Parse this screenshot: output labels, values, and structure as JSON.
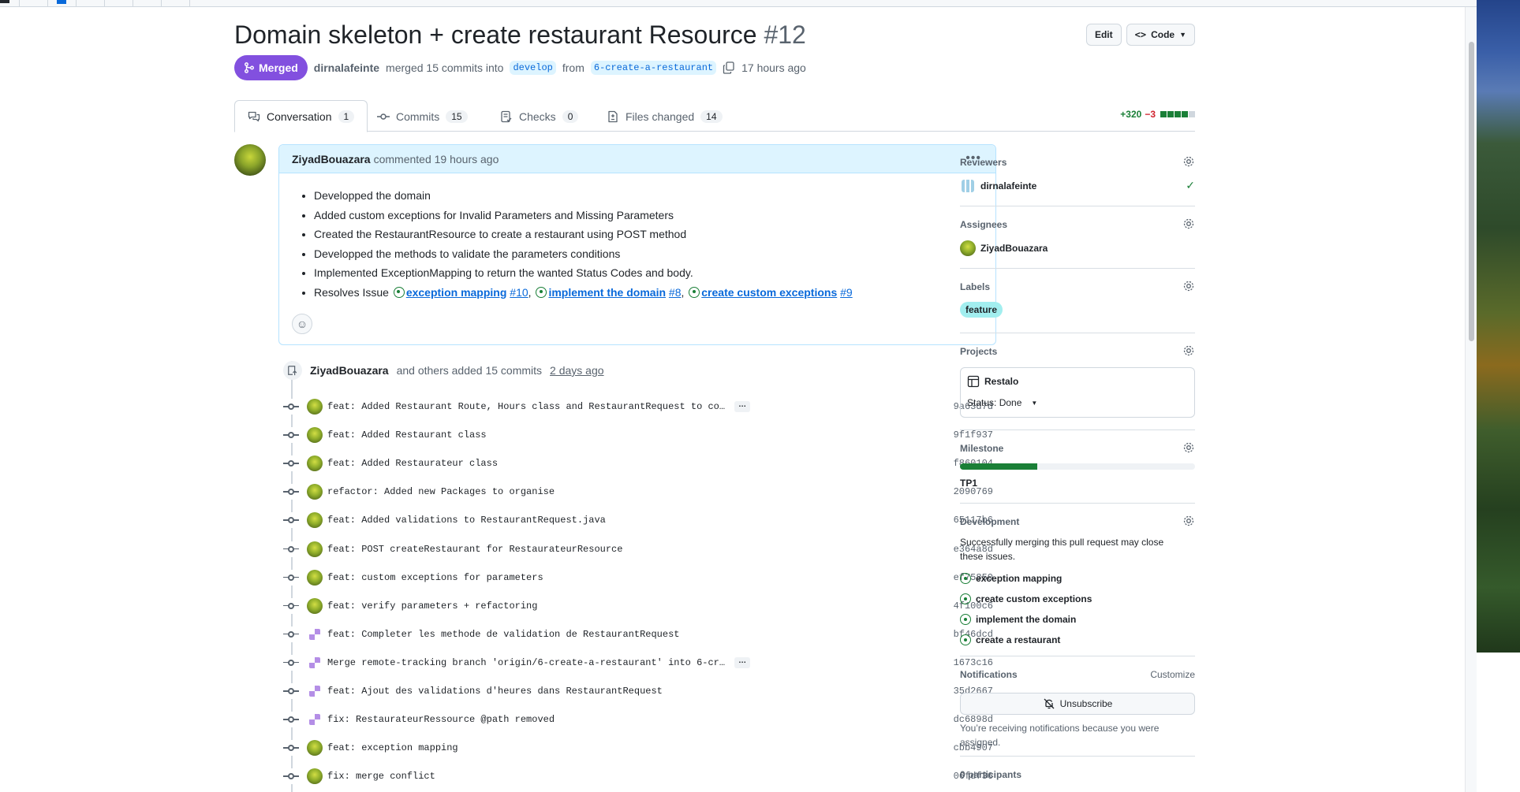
{
  "pr": {
    "title": "Domain skeleton + create restaurant Resource",
    "number": "#12",
    "edit_label": "Edit",
    "code_label": "Code",
    "status": "Merged",
    "merger": "dirnalafeinte",
    "merge_text": "merged 15 commits into",
    "base_branch": "develop",
    "from_text": "from",
    "head_branch": "6-create-a-restaurant",
    "time": "17 hours ago"
  },
  "tabs": [
    {
      "label": "Conversation",
      "count": "1"
    },
    {
      "label": "Commits",
      "count": "15"
    },
    {
      "label": "Checks",
      "count": "0"
    },
    {
      "label": "Files changed",
      "count": "14"
    }
  ],
  "diffstat": {
    "additions": "+320",
    "deletions": "−3"
  },
  "comment": {
    "author": "ZiyadBouazara",
    "meta": "commented 19 hours ago",
    "items": [
      "Developped the domain",
      "Added custom exceptions for Invalid Parameters and Missing Parameters",
      "Created the RestaurantResource to create a restaurant using POST method",
      "Developped the methods to validate the parameters conditions",
      "Implemented ExceptionMapping to return the wanted Status Codes and body."
    ],
    "resolves_prefix": "Resolves Issue",
    "issues": [
      {
        "title": "exception mapping",
        "num": "#10"
      },
      {
        "title": "implement the domain",
        "num": "#8"
      },
      {
        "title": "create custom exceptions",
        "num": "#9"
      }
    ],
    "separator": ","
  },
  "commits_header": {
    "author": "ZiyadBouazara",
    "text": "and others added 15 commits",
    "time": "2 days ago"
  },
  "commits": [
    {
      "msg": "feat: Added Restaurant Route, Hours class and RestaurantRequest to co…",
      "sha": "9a63d7d",
      "avatar": "green",
      "more": "…"
    },
    {
      "msg": "feat: Added Restaurant class",
      "sha": "9f1f937",
      "avatar": "green"
    },
    {
      "msg": "feat: Added Restaurateur class",
      "sha": "f860104",
      "avatar": "green"
    },
    {
      "msg": "refactor: Added new Packages to organise",
      "sha": "2090769",
      "avatar": "green"
    },
    {
      "msg": "feat: Added validations to RestaurantRequest.java",
      "sha": "65117b6",
      "avatar": "green"
    },
    {
      "msg": "feat: POST createRestaurant for RestaurateurResource",
      "sha": "e364a8d",
      "avatar": "green"
    },
    {
      "msg": "feat: custom exceptions for parameters",
      "sha": "ef75850",
      "avatar": "green"
    },
    {
      "msg": "feat: verify parameters + refactoring",
      "sha": "4f100c6",
      "avatar": "green"
    },
    {
      "msg": "feat: Completer les methode de validation de RestaurantRequest",
      "sha": "bf46dcd",
      "avatar": "purple"
    },
    {
      "msg": "Merge remote-tracking branch 'origin/6-create-a-restaurant' into 6-cr…",
      "sha": "1673c16",
      "avatar": "purple",
      "more": "…"
    },
    {
      "msg": "feat: Ajout des validations d'heures dans RestaurantRequest",
      "sha": "35d2667",
      "avatar": "purple"
    },
    {
      "msg": "fix: RestaurateurRessource @path removed",
      "sha": "dc6898d",
      "avatar": "purple"
    },
    {
      "msg": "feat: exception mapping",
      "sha": "cbb4907",
      "avatar": "green"
    },
    {
      "msg": "fix: merge conflict",
      "sha": "06fdf36",
      "avatar": "green"
    }
  ],
  "sidebar": {
    "reviewers": {
      "title": "Reviewers",
      "name": "dirnalafeinte"
    },
    "assignees": {
      "title": "Assignees",
      "name": "ZiyadBouazara"
    },
    "labels": {
      "title": "Labels",
      "label": "feature",
      "color": "#a2eeef"
    },
    "projects": {
      "title": "Projects",
      "name": "Restalo",
      "status": "Status: Done"
    },
    "milestone": {
      "title": "Milestone",
      "name": "TP1",
      "progress": 0.33
    },
    "development": {
      "title": "Development",
      "text": "Successfully merging this pull request may close these issues.",
      "issues": [
        "exception mapping",
        "create custom exceptions",
        "implement the domain",
        "create a restaurant"
      ]
    },
    "notifications": {
      "title": "Notifications",
      "customize": "Customize",
      "button": "Unsubscribe",
      "text": "You’re receiving notifications because you were assigned."
    },
    "participants": {
      "title": "0 participants"
    }
  },
  "colors": {
    "merged": "#8250df",
    "link": "#0969da",
    "success": "#1a7f37"
  }
}
